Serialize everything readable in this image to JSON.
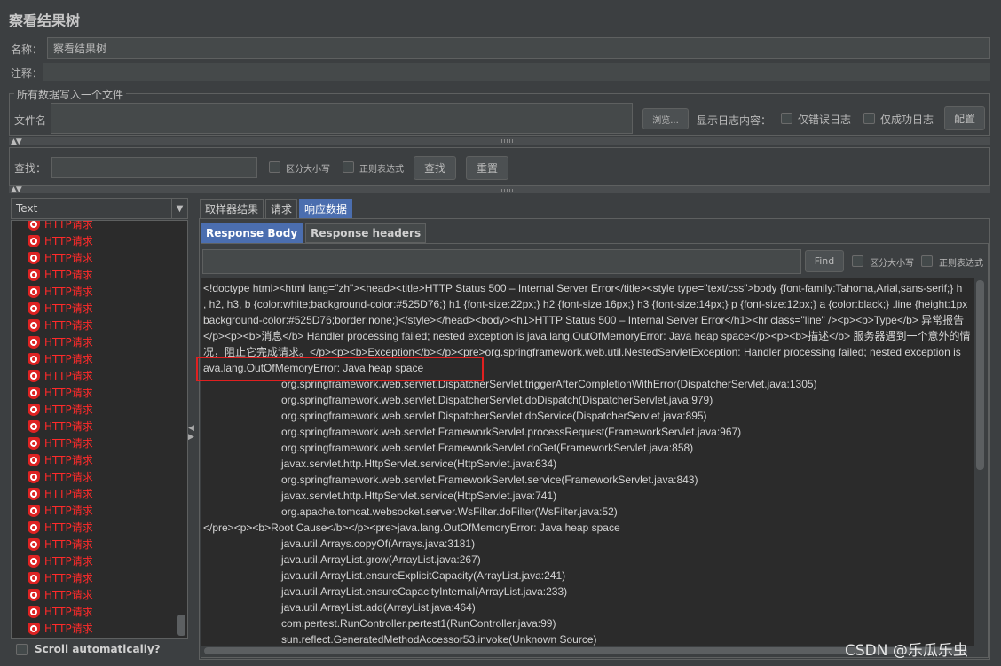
{
  "title": "察看结果树",
  "name_label": "名称：",
  "name_value": "察看结果树",
  "comment_label": "注释：",
  "file_section": {
    "legend": "所有数据写入一个文件",
    "file_label": "文件名",
    "browse_label": "浏览...",
    "log_label": "显示日志内容：",
    "errors_only": "仅错误日志",
    "success_only": "仅成功日志",
    "configure_label": "配置"
  },
  "search": {
    "label": "查找：",
    "case_label": "区分大小写",
    "regex_label": "正则表达式",
    "find_label": "查找",
    "reset_label": "重置"
  },
  "tree": {
    "renderer": "Text",
    "items": [
      "HTTP请求",
      "HTTP请求",
      "HTTP请求",
      "HTTP请求",
      "HTTP请求",
      "HTTP请求",
      "HTTP请求",
      "HTTP请求",
      "HTTP请求",
      "HTTP请求",
      "HTTP请求",
      "HTTP请求",
      "HTTP请求",
      "HTTP请求",
      "HTTP请求",
      "HTTP请求",
      "HTTP请求",
      "HTTP请求",
      "HTTP请求",
      "HTTP请求",
      "HTTP请求",
      "HTTP请求",
      "HTTP请求",
      "HTTP请求",
      "HTTP请求"
    ],
    "scroll_auto": "Scroll automatically?"
  },
  "tabs": [
    "取样器结果",
    "请求",
    "响应数据"
  ],
  "subtabs": [
    "Response Body",
    "Response headers"
  ],
  "response_search": {
    "find_label": "Find",
    "case_label": "区分大小写",
    "regex_label": "正则表达式"
  },
  "response_lines": [
    {
      "text": "<!doctype html><html lang=\"zh\"><head><title>HTTP Status 500 – Internal Server Error</title><style type=\"text/css\">body {font-family:Tahoma,Arial,sans-serif;} h",
      "indent": false
    },
    {
      "text": ", h2, h3, b {color:white;background-color:#525D76;} h1 {font-size:22px;} h2 {font-size:16px;} h3 {font-size:14px;} p {font-size:12px;} a {color:black;} .line {height:1px",
      "indent": false
    },
    {
      "text": "background-color:#525D76;border:none;}</style></head><body><h1>HTTP Status 500 – Internal Server Error</h1><hr class=\"line\" /><p><b>Type</b> 异常报告",
      "indent": false
    },
    {
      "text": "</p><p><b>消息</b> Handler processing failed; nested exception is java.lang.OutOfMemoryError: Java heap space</p><p><b>描述</b> 服务器遇到一个意外的情",
      "indent": false
    },
    {
      "text": "况，阻止它完成请求。</p><p><b>Exception</b></p><pre>org.springframework.web.util.NestedServletException: Handler processing failed; nested exception is",
      "indent": false
    },
    {
      "text": "ava.lang.OutOfMemoryError: Java heap space",
      "indent": false
    },
    {
      "text": "org.springframework.web.servlet.DispatcherServlet.triggerAfterCompletionWithError(DispatcherServlet.java:1305)",
      "indent": true
    },
    {
      "text": "org.springframework.web.servlet.DispatcherServlet.doDispatch(DispatcherServlet.java:979)",
      "indent": true
    },
    {
      "text": "org.springframework.web.servlet.DispatcherServlet.doService(DispatcherServlet.java:895)",
      "indent": true
    },
    {
      "text": "org.springframework.web.servlet.FrameworkServlet.processRequest(FrameworkServlet.java:967)",
      "indent": true
    },
    {
      "text": "org.springframework.web.servlet.FrameworkServlet.doGet(FrameworkServlet.java:858)",
      "indent": true
    },
    {
      "text": "javax.servlet.http.HttpServlet.service(HttpServlet.java:634)",
      "indent": true
    },
    {
      "text": "org.springframework.web.servlet.FrameworkServlet.service(FrameworkServlet.java:843)",
      "indent": true
    },
    {
      "text": "javax.servlet.http.HttpServlet.service(HttpServlet.java:741)",
      "indent": true
    },
    {
      "text": "org.apache.tomcat.websocket.server.WsFilter.doFilter(WsFilter.java:52)",
      "indent": true
    },
    {
      "text": "</pre><p><b>Root Cause</b></p><pre>java.lang.OutOfMemoryError: Java heap space",
      "indent": false
    },
    {
      "text": "java.util.Arrays.copyOf(Arrays.java:3181)",
      "indent": true
    },
    {
      "text": "java.util.ArrayList.grow(ArrayList.java:267)",
      "indent": true
    },
    {
      "text": "java.util.ArrayList.ensureExplicitCapacity(ArrayList.java:241)",
      "indent": true
    },
    {
      "text": "java.util.ArrayList.ensureCapacityInternal(ArrayList.java:233)",
      "indent": true
    },
    {
      "text": "java.util.ArrayList.add(ArrayList.java:464)",
      "indent": true
    },
    {
      "text": "com.pertest.RunController.pertest1(RunController.java:99)",
      "indent": true
    },
    {
      "text": "sun.reflect.GeneratedMethodAccessor53.invoke(Unknown Source)",
      "indent": true
    }
  ],
  "watermark": "CSDN @乐瓜乐虫",
  "colors": {
    "accent": "#4b6eaf",
    "error": "#ff2a2a",
    "highlight_box": "#e02020"
  }
}
